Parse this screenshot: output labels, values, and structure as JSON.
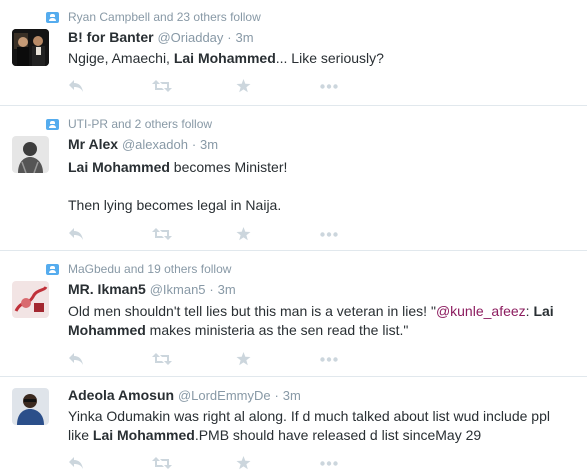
{
  "tweets": [
    {
      "context": "Ryan Campbell and 23 others follow",
      "name": "B! for Banter",
      "handle": "@Oriadday",
      "dot": "·",
      "time": "3m",
      "lines": [
        {
          "pre": "Ngige, Amaechi, ",
          "bold": "Lai Mohammed",
          "post": "... Like seriously?"
        }
      ]
    },
    {
      "context": "UTI-PR and 2 others follow",
      "name": "Mr Alex",
      "handle": "@alexadoh",
      "dot": "·",
      "time": "3m",
      "lines": [
        {
          "pre": "",
          "bold": "Lai Mohammed",
          "post": " becomes Minister!"
        },
        {
          "pre": "Then lying becomes legal in Naija.",
          "bold": "",
          "post": ""
        }
      ]
    },
    {
      "context": "MaGbedu and 19 others follow",
      "name": "MR. Ikman5",
      "handle": "@Ikman5",
      "dot": "·",
      "time": "3m",
      "text_pre": "Old men shouldn't tell lies but this man is a veteran in lies! \"",
      "mention": "@kunle_afeez",
      "text_mid": ": ",
      "bold": "Lai Mohammed",
      "text_post": " makes ministeria as the sen read the list.\""
    },
    {
      "context": "",
      "name": "Adeola Amosun",
      "handle": "@LordEmmyDe",
      "dot": "·",
      "time": "3m",
      "text_pre": "Yinka Odumakin was right al along. If d much talked about list wud include ppl like ",
      "bold": "Lai Mohammed",
      "text_post": ".PMB should have released d list sinceMay 29"
    }
  ],
  "icons": {
    "reply": "reply-icon",
    "retweet": "retweet-icon",
    "favorite": "star-icon",
    "more": "more-icon",
    "context": "follow-context-icon"
  },
  "colors": {
    "name": "#292f33",
    "meta": "#8899a6",
    "accent": "#55acee",
    "mention": "#8c1c5f",
    "action": "#ccd6dd",
    "divider": "#e1e8ed"
  }
}
